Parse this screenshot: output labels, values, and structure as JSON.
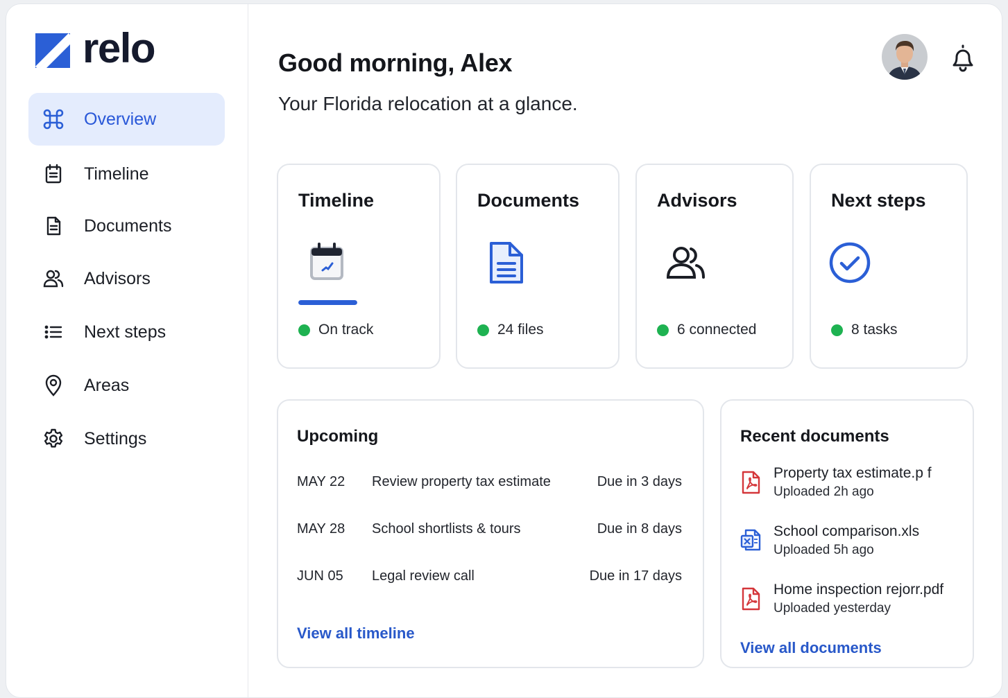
{
  "brand": {
    "name": "relo"
  },
  "sidebar": {
    "items": [
      {
        "label": "Overview",
        "icon": "command-grid-icon",
        "active": true
      },
      {
        "label": "Timeline",
        "icon": "calendar-list-icon",
        "active": false
      },
      {
        "label": "Documents",
        "icon": "document-icon",
        "active": false
      },
      {
        "label": "Advisors",
        "icon": "people-icon",
        "active": false
      },
      {
        "label": "Next steps",
        "icon": "list-icon",
        "active": false
      },
      {
        "label": "Areas",
        "icon": "map-pin-icon",
        "active": false
      },
      {
        "label": "Settings",
        "icon": "gear-icon",
        "active": false
      }
    ]
  },
  "header": {
    "greeting": "Good morning, Alex",
    "subtitle": "Your Florida relocation at a glance."
  },
  "cards": [
    {
      "title": "Timeline",
      "status": "On track",
      "icon": "calendar-icon",
      "progress": 1.0
    },
    {
      "title": "Documents",
      "status": "24 files",
      "icon": "document-icon"
    },
    {
      "title": "Advisors",
      "status": "6 connected",
      "icon": "people-icon"
    },
    {
      "title": "Next steps",
      "status": "8 tasks",
      "icon": "check-circle-icon"
    }
  ],
  "upcoming": {
    "title": "Upcoming",
    "rows": [
      {
        "date": "MAY 22",
        "task": "Review property tax estimate",
        "due": "Due in 3 days"
      },
      {
        "date": "MAY 28",
        "task": "School shortlists & tours",
        "due": "Due in 8 days"
      },
      {
        "date": "JUN 05",
        "task": "Legal review call",
        "due": "Due in 17 days"
      }
    ],
    "link": "View all timeline"
  },
  "recent_documents": {
    "title": "Recent documents",
    "items": [
      {
        "name": "Property tax estimate.p f",
        "time": "Uploaded 2h ago",
        "icon": "pdf-icon"
      },
      {
        "name": "School comparison.xls",
        "time": "Uploaded 5h ago",
        "icon": "spreadsheet-icon"
      },
      {
        "name": "Home inspection rejorr.pdf",
        "time": "Uploaded yesterday",
        "icon": "pdf-icon"
      }
    ],
    "link": "View all documents"
  },
  "colors": {
    "accent": "#2b5fd6",
    "status_green": "#1eb251",
    "active_bg": "#e4ecfd",
    "pdf_red": "#d4363a"
  }
}
